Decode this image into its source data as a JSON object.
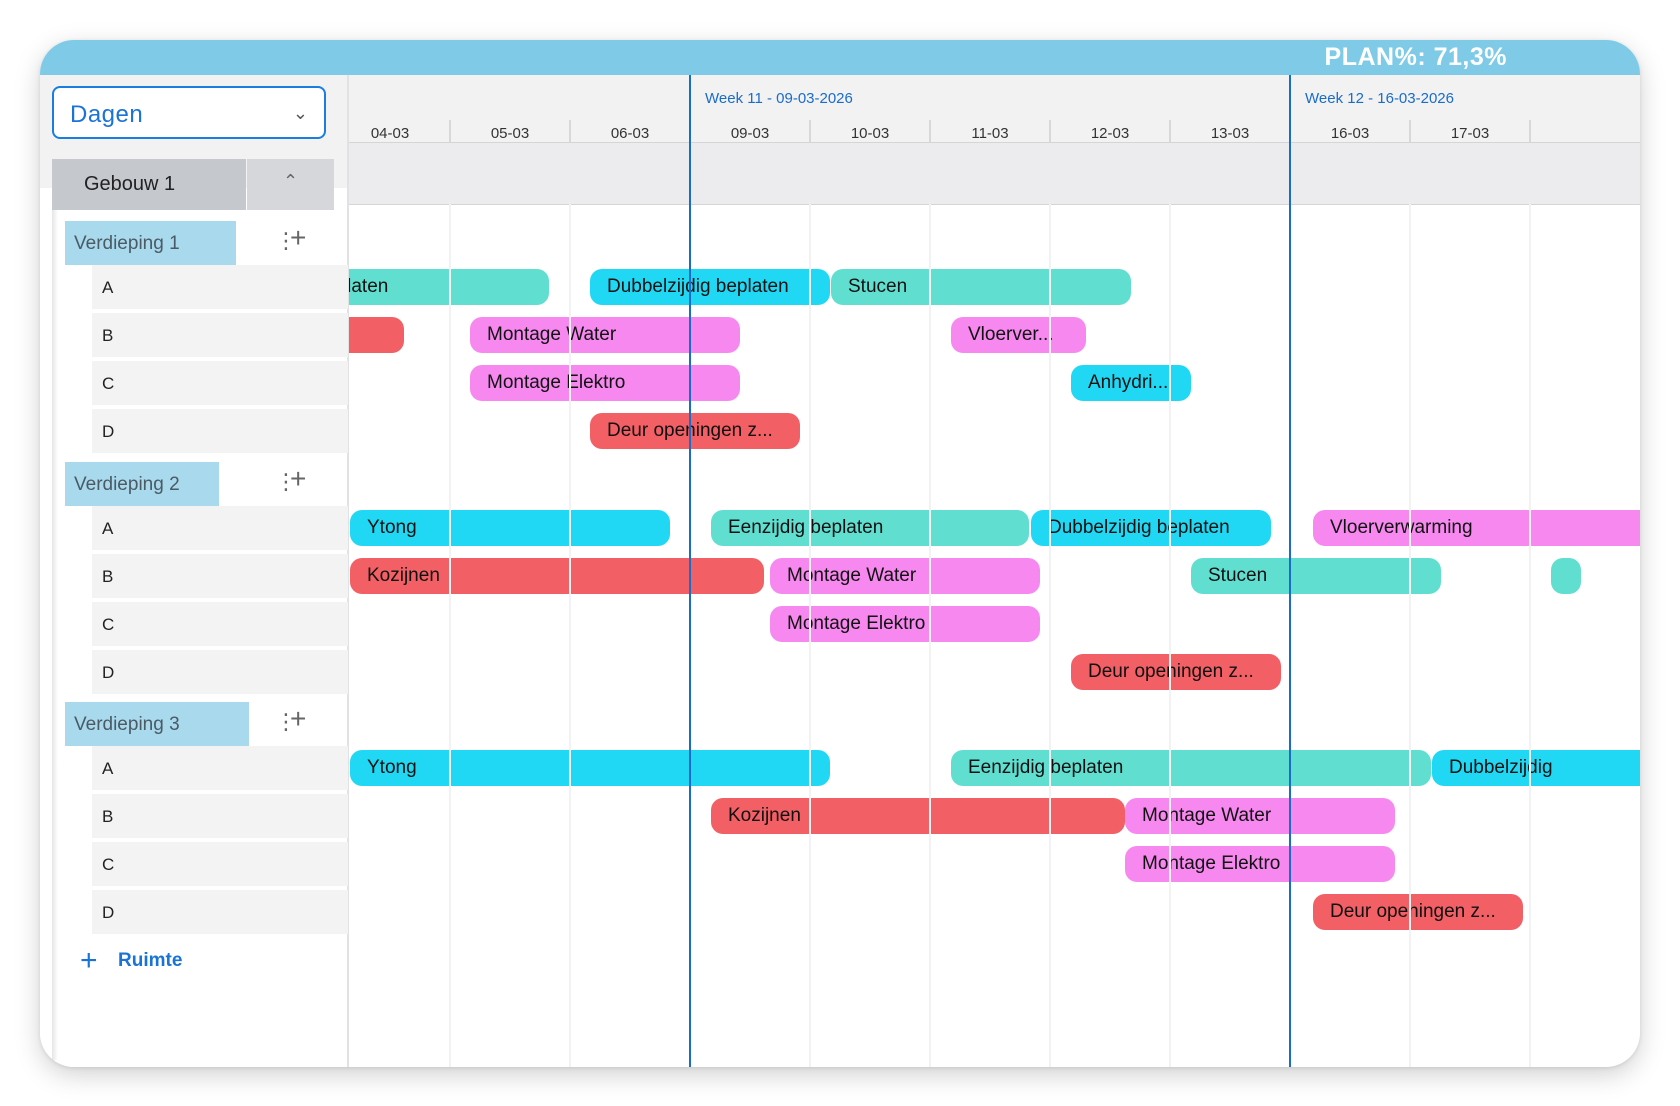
{
  "plan": "PLAN%: 71,3%",
  "view_select": {
    "value": "Dagen"
  },
  "building": {
    "label": "Gebouw 1"
  },
  "floors": [
    {
      "label": "Verdieping 1",
      "rooms": [
        "A",
        "B",
        "C",
        "D"
      ]
    },
    {
      "label": "Verdieping 2",
      "rooms": [
        "A",
        "B",
        "C",
        "D"
      ]
    },
    {
      "label": "Verdieping 3",
      "rooms": [
        "A",
        "B",
        "C",
        "D"
      ]
    }
  ],
  "add_room_label": "Ruimte",
  "weeks": [
    "Week 11 - 09-03-2026",
    "Week 12 - 16-03-2026"
  ],
  "days": [
    "04-03",
    "05-03",
    "06-03",
    "09-03",
    "10-03",
    "11-03",
    "12-03",
    "13-03",
    "16-03",
    "17-03"
  ],
  "colors": {
    "teal": "#60dfd0",
    "cyan": "#21d8f4",
    "red": "#f25f65",
    "pink": "#f788f0",
    "blue_accent": "#1a73d6",
    "header_blue": "#7fcbe7"
  },
  "tasks": [
    {
      "label": "beplaten",
      "text": "eplaten",
      "floor": 1,
      "room": "A",
      "color": "teal"
    },
    {
      "label": "Dubbelzijdig beplaten",
      "text": "Dubbelzijdig beplaten",
      "floor": 1,
      "room": "A",
      "color": "cyan"
    },
    {
      "label": "Stucen",
      "text": "Stucen",
      "floor": 1,
      "room": "A",
      "color": "teal"
    },
    {
      "label": "",
      "text": "",
      "floor": 1,
      "room": "B",
      "color": "red"
    },
    {
      "label": "Montage Water",
      "text": "Montage Water",
      "floor": 1,
      "room": "B",
      "color": "pink"
    },
    {
      "label": "Vloerverwarming",
      "text": "Vloerver...",
      "floor": 1,
      "room": "B",
      "color": "pink"
    },
    {
      "label": "Montage Elektro",
      "text": "Montage Elektro",
      "floor": 1,
      "room": "C",
      "color": "pink"
    },
    {
      "label": "Anhydriet",
      "text": "Anhydri...",
      "floor": 1,
      "room": "C",
      "color": "cyan"
    },
    {
      "label": "Deur openingen zagen",
      "text": "Deur openingen z...",
      "floor": 1,
      "room": "D",
      "color": "red"
    },
    {
      "label": "Ytong",
      "text": "Ytong",
      "floor": 2,
      "room": "A",
      "color": "cyan"
    },
    {
      "label": "Eenzijdig beplaten",
      "text": "Eenzijdig beplaten",
      "floor": 2,
      "room": "A",
      "color": "teal"
    },
    {
      "label": "Dubbelzijdig beplaten",
      "text": "Dubbelzijdig beplaten",
      "floor": 2,
      "room": "A",
      "color": "cyan"
    },
    {
      "label": "Vloerverwarming",
      "text": "Vloerverwarming",
      "floor": 2,
      "room": "A",
      "color": "pink"
    },
    {
      "label": "Kozijnen",
      "text": "Kozijnen",
      "floor": 2,
      "room": "B",
      "color": "red"
    },
    {
      "label": "Montage Water",
      "text": "Montage Water",
      "floor": 2,
      "room": "B",
      "color": "pink"
    },
    {
      "label": "Stucen",
      "text": "Stucen",
      "floor": 2,
      "room": "B",
      "color": "teal"
    },
    {
      "label": "",
      "text": "",
      "floor": 2,
      "room": "B",
      "color": "teal"
    },
    {
      "label": "Montage Elektro",
      "text": "Montage Elektro",
      "floor": 2,
      "room": "C",
      "color": "pink"
    },
    {
      "label": "Deur openingen zagen",
      "text": "Deur openingen z...",
      "floor": 2,
      "room": "D",
      "color": "red"
    },
    {
      "label": "Ytong",
      "text": "Ytong",
      "floor": 3,
      "room": "A",
      "color": "cyan"
    },
    {
      "label": "Eenzijdig beplaten",
      "text": "Eenzijdig beplaten",
      "floor": 3,
      "room": "A",
      "color": "teal"
    },
    {
      "label": "Dubbelzijdig beplaten",
      "text": "Dubbelzijdig",
      "floor": 3,
      "room": "A",
      "color": "cyan"
    },
    {
      "label": "Kozijnen",
      "text": "Kozijnen",
      "floor": 3,
      "room": "B",
      "color": "red"
    },
    {
      "label": "Montage Water",
      "text": "Montage Water",
      "floor": 3,
      "room": "B",
      "color": "pink"
    },
    {
      "label": "Montage Elektro",
      "text": "Montage Elektro",
      "floor": 3,
      "room": "C",
      "color": "pink"
    },
    {
      "label": "Deur openingen zagen",
      "text": "Deur openingen z...",
      "floor": 3,
      "room": "D",
      "color": "red"
    }
  ]
}
